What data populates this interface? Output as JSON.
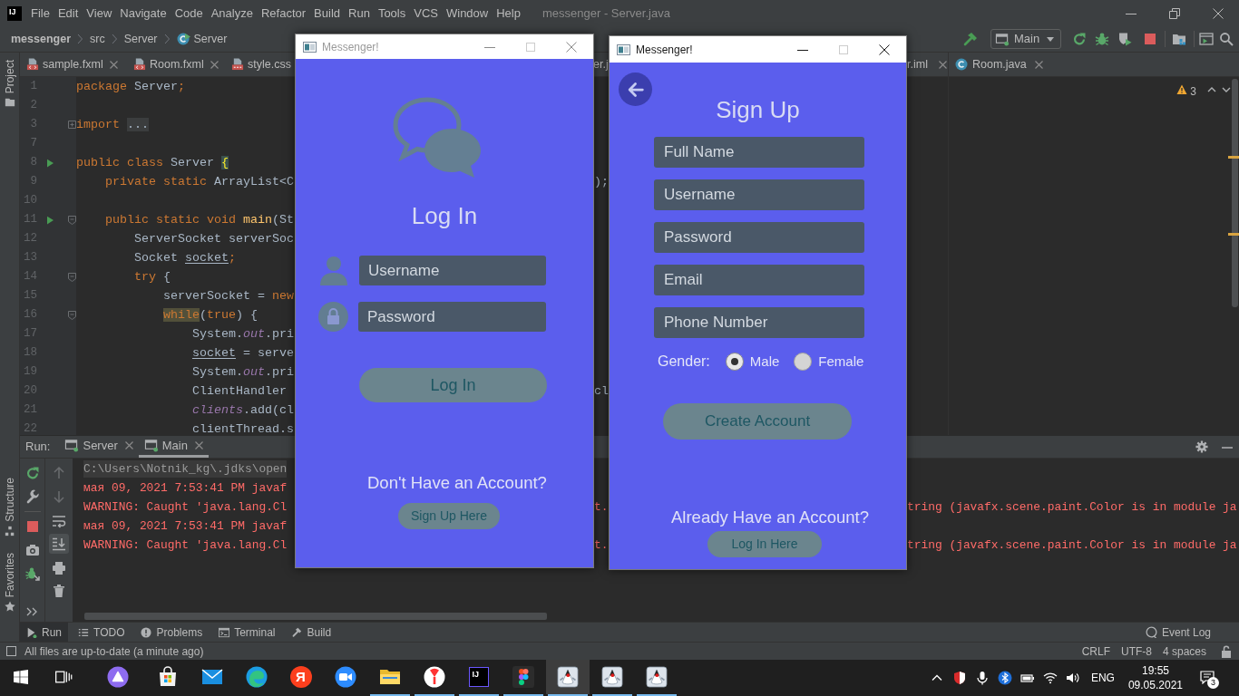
{
  "title_bar": {
    "logo": "IJ",
    "menu": [
      "File",
      "Edit",
      "View",
      "Navigate",
      "Code",
      "Analyze",
      "Refactor",
      "Build",
      "Run",
      "Tools",
      "VCS",
      "Window",
      "Help"
    ],
    "title": "messenger - Server.java"
  },
  "navigation_bar": {
    "breadcrumbs": [
      {
        "label": "messenger",
        "kind": "project"
      },
      {
        "label": "src",
        "kind": "folder"
      },
      {
        "label": "Server",
        "kind": "folder"
      },
      {
        "label": "Server",
        "kind": "class"
      }
    ],
    "run_config": "Main"
  },
  "side_tabs": [
    {
      "label": "Project",
      "kind": "project"
    },
    {
      "label": "Structure",
      "kind": "structure"
    },
    {
      "label": "Favorites",
      "kind": "favorites"
    }
  ],
  "editor": {
    "tabs": [
      {
        "label": "sample.fxml",
        "kind": "fxml",
        "close_button": true
      },
      {
        "label": "Room.fxml",
        "kind": "fxml",
        "close_button": true
      },
      {
        "label": "style.css",
        "kind": "css",
        "close_button": false
      },
      {
        "label": "er.j",
        "kind": "fragment",
        "close_button": false
      },
      {
        "label": "r.iml",
        "kind": "fragment",
        "close_button": true
      }
    ],
    "lines": [
      {
        "number": "1",
        "segments": [
          {
            "kind": "keyword",
            "text": "package"
          },
          {
            "kind": "plain",
            "text": " Server"
          },
          {
            "kind": "keyword",
            "text": ";"
          }
        ]
      },
      {
        "number": "2"
      },
      {
        "number": "3",
        "gutter": [
          {
            "kind": "fold",
            "collapsed": true
          }
        ],
        "segments": [
          {
            "kind": "keyword",
            "text": "import "
          },
          {
            "kind": "folded",
            "text": "..."
          }
        ]
      },
      {
        "number": "7"
      },
      {
        "number": "8",
        "gutter": [
          {
            "kind": "run"
          }
        ],
        "segments": [
          {
            "kind": "keyword",
            "text": "public class "
          },
          {
            "kind": "plain",
            "text": "Server "
          },
          {
            "kind": "brace",
            "text": "{"
          }
        ]
      },
      {
        "number": "9",
        "segments": [
          {
            "kind": "keyword",
            "text": "    private static "
          },
          {
            "kind": "plain",
            "text": "ArrayList<C"
          }
        ],
        "fragment": ");"
      },
      {
        "number": "10"
      },
      {
        "number": "11",
        "gutter": [
          {
            "kind": "run"
          },
          {
            "kind": "fold",
            "collapsed": false
          }
        ],
        "segments": [
          {
            "kind": "keyword",
            "text": "    public static void "
          },
          {
            "kind": "method",
            "text": "main"
          },
          {
            "kind": "plain",
            "text": "(St"
          }
        ]
      },
      {
        "number": "12",
        "segments": [
          {
            "kind": "plain",
            "text": "        ServerSocket serverSoc"
          }
        ]
      },
      {
        "number": "13",
        "segments": [
          {
            "kind": "plain",
            "text": "        Socket "
          },
          {
            "kind": "underlined",
            "text": "socket"
          },
          {
            "kind": "keyword",
            "text": ";"
          }
        ]
      },
      {
        "number": "14",
        "gutter": [
          {
            "kind": "fold",
            "collapsed": false
          }
        ],
        "segments": [
          {
            "kind": "keyword",
            "text": "        try "
          },
          {
            "kind": "plain",
            "text": "{"
          }
        ]
      },
      {
        "number": "15",
        "segments": [
          {
            "kind": "plain",
            "text": "            serverSocket = "
          },
          {
            "kind": "keyword",
            "text": "new"
          }
        ]
      },
      {
        "number": "16",
        "gutter": [
          {
            "kind": "fold",
            "collapsed": false
          }
        ],
        "segments": [
          {
            "kind": "highlight",
            "text": "            while"
          },
          {
            "kind": "plain",
            "text": "("
          },
          {
            "kind": "keyword",
            "text": "true"
          },
          {
            "kind": "plain",
            "text": ") {"
          }
        ]
      },
      {
        "number": "17",
        "segments": [
          {
            "kind": "plain",
            "text": "                System."
          },
          {
            "kind": "static",
            "text": "out"
          },
          {
            "kind": "plain",
            "text": ".pri"
          }
        ]
      },
      {
        "number": "18",
        "segments": [
          {
            "kind": "underlined",
            "text": "                socket"
          },
          {
            "kind": "plain",
            "text": " = serve"
          }
        ]
      },
      {
        "number": "19",
        "segments": [
          {
            "kind": "plain",
            "text": "                System."
          },
          {
            "kind": "static",
            "text": "out"
          },
          {
            "kind": "plain",
            "text": ".pri"
          }
        ]
      },
      {
        "number": "20",
        "segments": [
          {
            "kind": "plain",
            "text": "                ClientHandler"
          }
        ],
        "fragment": "cl"
      },
      {
        "number": "21",
        "segments": [
          {
            "kind": "static",
            "text": "                clients"
          },
          {
            "kind": "plain",
            "text": ".add(cl"
          }
        ]
      },
      {
        "number": "22",
        "segments": [
          {
            "kind": "plain",
            "text": "                clientThread.s"
          }
        ]
      }
    ]
  },
  "split_pane": {
    "tab": "Room.java",
    "warnings": "3"
  },
  "run_panel": {
    "label": "Run:",
    "tabs": [
      {
        "label": "Server",
        "selected": false
      },
      {
        "label": "Main",
        "selected": true
      }
    ],
    "tools": [
      {
        "kind": "up",
        "disabled": true,
        "on": false
      },
      {
        "kind": "down",
        "disabled": true,
        "on": false
      },
      {
        "kind": "wrap",
        "disabled": false,
        "on": false
      },
      {
        "kind": "scroll-end",
        "disabled": false,
        "on": true
      },
      {
        "kind": "print",
        "disabled": false,
        "on": false
      },
      {
        "kind": "clear",
        "disabled": false,
        "on": false
      }
    ],
    "console": [
      {
        "kind": "command",
        "text": "C:\\Users\\Notnik_kg\\.jdks\\open"
      },
      {
        "kind": "error",
        "text": "мая 09, 2021 7:53:41 PM javaf"
      },
      {
        "kind": "error",
        "text": "WARNING: Caught 'java.lang.Cl",
        "fragments": [
          "t.",
          "tring (javafx.scene.paint.Color is in module ja"
        ]
      },
      {
        "kind": "error",
        "text": "мая 09, 2021 7:53:41 PM javaf"
      },
      {
        "kind": "error",
        "text": "WARNING: Caught 'java.lang.Cl",
        "fragments": [
          "t.",
          "tring (javafx.scene.paint.Color is in module ja"
        ]
      }
    ]
  },
  "tool_windows": {
    "tabs": [
      {
        "label": "Run",
        "kind": "run",
        "selected": true
      },
      {
        "label": "TODO",
        "kind": "todo",
        "selected": false
      },
      {
        "label": "Problems",
        "kind": "problems",
        "selected": false
      },
      {
        "label": "Terminal",
        "kind": "terminal",
        "selected": false
      },
      {
        "label": "Build",
        "kind": "build",
        "selected": false
      }
    ],
    "event_log": "Event Log"
  },
  "status_bar": {
    "message": "All files are up-to-date (a minute ago)",
    "items": [
      "CRLF",
      "UTF-8",
      "4 spaces"
    ]
  },
  "login_window": {
    "title": "Messenger!",
    "active": false,
    "controls": [
      {
        "kind": "minimize",
        "disabled": false
      },
      {
        "kind": "maximize",
        "disabled": true
      },
      {
        "kind": "close",
        "disabled": false
      }
    ],
    "heading": "Log In",
    "fields": [
      {
        "placeholder": "Username",
        "kind": "user"
      },
      {
        "placeholder": "Password",
        "kind": "lock"
      }
    ],
    "button": "Log In",
    "prompt": "Don't Have an Account?",
    "link": "Sign Up Here"
  },
  "signup_window": {
    "title": "Messenger!",
    "active": true,
    "controls": [
      {
        "kind": "minimize",
        "disabled": false
      },
      {
        "kind": "maximize",
        "disabled": true
      },
      {
        "kind": "close",
        "disabled": false
      }
    ],
    "heading": "Sign Up",
    "fields": [
      {
        "placeholder": "Full Name"
      },
      {
        "placeholder": "Username"
      },
      {
        "placeholder": "Password"
      },
      {
        "placeholder": "Email"
      },
      {
        "placeholder": "Phone Number"
      }
    ],
    "gender": {
      "label": "Gender:",
      "options": [
        {
          "label": "Male",
          "selected": true
        },
        {
          "label": "Female",
          "selected": false
        }
      ]
    },
    "button": "Create Account",
    "prompt": "Already Have an Account?",
    "link": "Log In Here"
  },
  "taskbar": {
    "apps": [
      {
        "kind": "start",
        "active": false,
        "running": false
      },
      {
        "kind": "task-view",
        "active": false,
        "running": false
      },
      {
        "kind": "assistant",
        "active": false,
        "running": false
      },
      {
        "kind": "store",
        "active": false,
        "running": false
      },
      {
        "kind": "mail",
        "active": false,
        "running": false
      },
      {
        "kind": "edge",
        "active": false,
        "running": false
      },
      {
        "kind": "yandex",
        "glyph": "Я",
        "active": false,
        "running": false
      },
      {
        "kind": "zoom",
        "active": false,
        "running": false
      },
      {
        "kind": "explorer",
        "active": false,
        "running": true
      },
      {
        "kind": "yandex-browser",
        "active": false,
        "running": true
      },
      {
        "kind": "intellij",
        "glyph": "IJ",
        "active": false,
        "running": true
      },
      {
        "kind": "figma",
        "active": false,
        "running": true
      },
      {
        "kind": "java",
        "active": true,
        "running": true
      },
      {
        "kind": "java",
        "active": false,
        "running": true
      },
      {
        "kind": "java",
        "active": false,
        "running": true
      }
    ],
    "language": "ENG",
    "time": "19:55",
    "date": "09.05.2021",
    "notifications": "3"
  }
}
